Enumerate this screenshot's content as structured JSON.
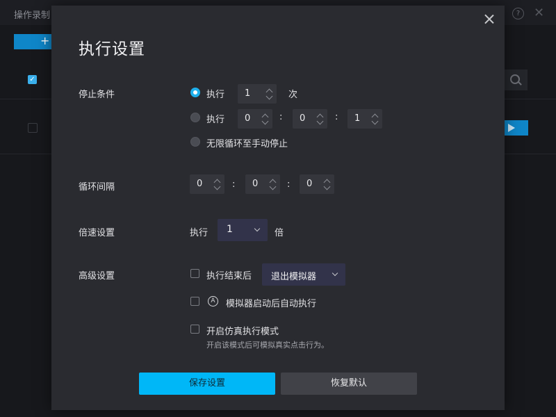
{
  "background": {
    "title": "操作录制",
    "add_label": "+",
    "help_label": "?",
    "close_label": "✕",
    "check_label": "✓"
  },
  "dialog": {
    "title": "执行设置",
    "stop": {
      "label": "停止条件",
      "option1_label": "执行",
      "option1_count": "1",
      "option1_unit": "次",
      "option2_label": "执行",
      "option2_h": "0",
      "option2_m": "0",
      "option2_s": "1",
      "option3_label": "无限循环至手动停止",
      "selected": "option1"
    },
    "interval": {
      "label": "循环间隔",
      "h": "0",
      "m": "0",
      "s": "0"
    },
    "speed": {
      "label": "倍速设置",
      "prefix": "执行",
      "value": "1",
      "suffix": "倍"
    },
    "advanced": {
      "label": "高级设置",
      "after_exec_label": "执行结束后",
      "after_exec_value": "退出模拟器",
      "auto_exec_icon_text": "A",
      "auto_exec_label": "模拟器启动后自动执行",
      "sim_mode_label": "开启仿真执行模式",
      "sim_mode_hint": "开启该模式后可模拟真实点击行为。"
    },
    "colon": ":",
    "buttons": {
      "save": "保存设置",
      "reset": "恢复默认"
    }
  },
  "colors": {
    "accent": "#00b7f7",
    "dialog_bg": "#2a2b30"
  }
}
